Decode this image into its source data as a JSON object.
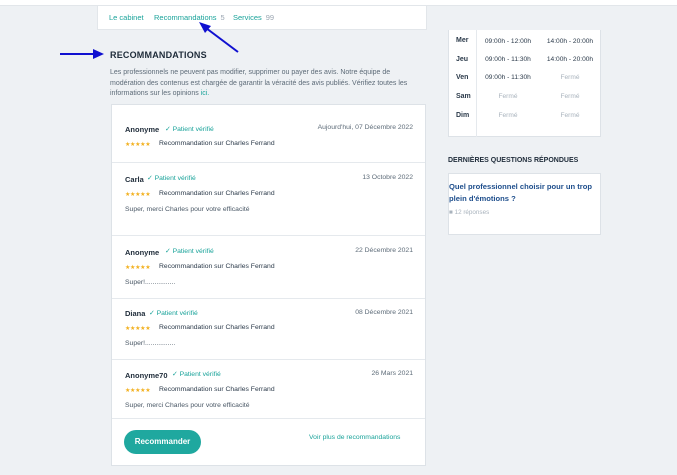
{
  "tabs": [
    {
      "label": "Le cabinet",
      "count": ""
    },
    {
      "label": "Recommandations",
      "count": "5"
    },
    {
      "label": "Services",
      "count": "99"
    }
  ],
  "section": {
    "title": "RECOMMANDATIONS",
    "description": "Les professionnels ne peuvent pas modifier, supprimer ou payer des avis. Notre équipe de modération des contenus est chargée de garantir la véracité des avis publiés. Vérifiez toutes les informations sur les opinions",
    "link": "ici."
  },
  "reviews": [
    {
      "name": "Anonyme",
      "verified": "✓ Patient vérifié",
      "date": "Aujourd'hui, 07 Décembre 2022",
      "stars": "★★★★★",
      "subject": "Recommandation sur Charles Ferrand",
      "text": ""
    },
    {
      "name": "Carla",
      "verified": "✓ Patient vérifié",
      "date": "13 Octobre 2022",
      "stars": "★★★★★",
      "subject": "Recommandation sur Charles Ferrand",
      "text": "Super, merci Charles pour votre efficacité"
    },
    {
      "name": "Anonyme",
      "verified": "✓ Patient vérifié",
      "date": "22 Décembre 2021",
      "stars": "★★★★★",
      "subject": "Recommandation sur Charles Ferrand",
      "text": "Super!................"
    },
    {
      "name": "Diana",
      "verified": "✓ Patient vérifié",
      "date": "08 Décembre 2021",
      "stars": "★★★★★",
      "subject": "Recommandation sur Charles Ferrand",
      "text": "Super!................"
    },
    {
      "name": "Anonyme70",
      "verified": "✓ Patient vérifié",
      "date": "26 Mars 2021",
      "stars": "★★★★★",
      "subject": "Recommandation sur Charles Ferrand",
      "text": "Super, merci Charles pour votre efficacité"
    }
  ],
  "actions": {
    "recommend": "Recommander",
    "more": "Voir plus de recommandations"
  },
  "hours": [
    {
      "day": "Mer",
      "morning": "09:00h - 12:00h",
      "afternoon": "14:00h - 20:00h"
    },
    {
      "day": "Jeu",
      "morning": "09:00h - 11:30h",
      "afternoon": "14:00h - 20:00h"
    },
    {
      "day": "Ven",
      "morning": "09:00h - 11:30h",
      "afternoon": "Fermé"
    },
    {
      "day": "Sam",
      "morning": "Fermé",
      "afternoon": "Fermé"
    },
    {
      "day": "Dim",
      "morning": "Fermé",
      "afternoon": "Fermé"
    }
  ],
  "questions": {
    "title": "DERNIÈRES QUESTIONS RÉPONDUES",
    "item": "Quel professionnel choisir pour un trop plein d'émotions ?",
    "answers": "12 réponses"
  },
  "colors": {
    "accent": "#1fa89f",
    "annotation_arrow": "#1010d0",
    "stars": "#f2b01e"
  }
}
